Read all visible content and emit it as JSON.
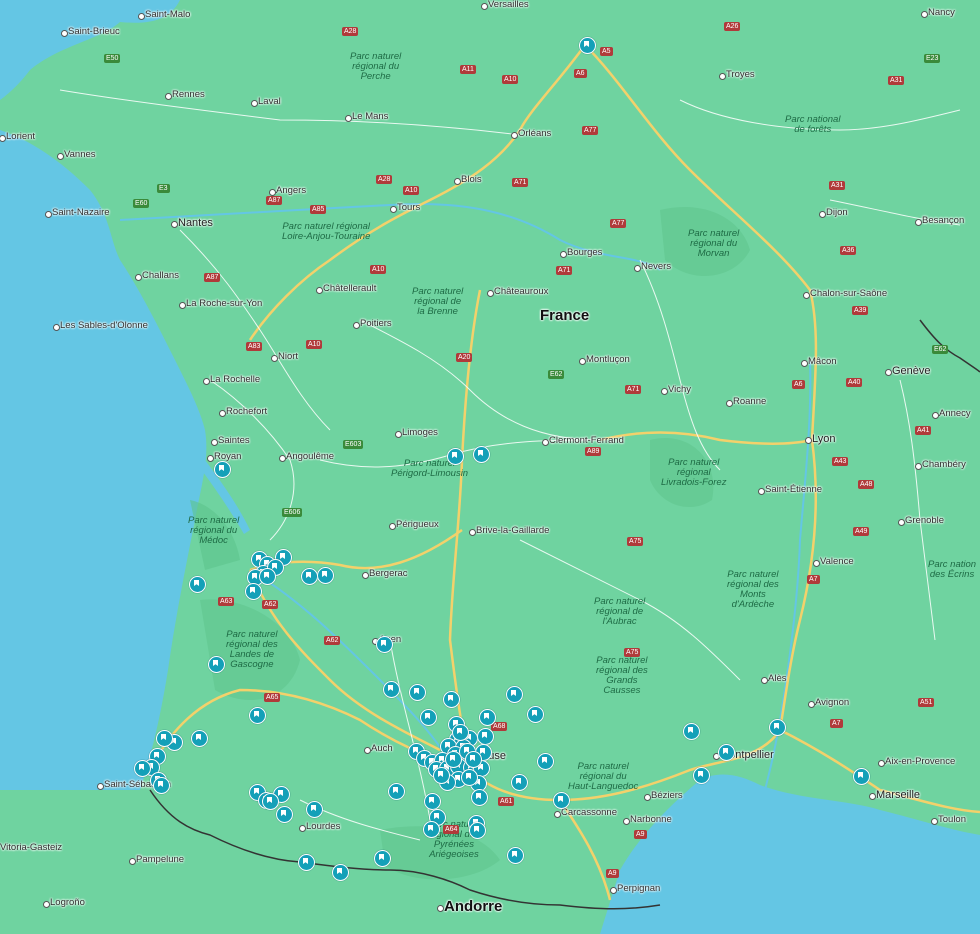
{
  "country_label": "France",
  "colors": {
    "land": "#6fd3a0",
    "sea": "#64c6e4",
    "road_major": "#f3d16b",
    "road_minor": "#ffffff",
    "marker": "#14a0b8",
    "park": "#5ec48c"
  },
  "cities": [
    "Versailles",
    "Nancy",
    "Saint-Malo",
    "Saint-Brieuc",
    "Rennes",
    "Laval",
    "Le Mans",
    "Orléans",
    "Troyes",
    "Lorient",
    "Vannes",
    "Angers",
    "Blois",
    "Tours",
    "Dijon",
    "Besançon",
    "Saint-Nazaire",
    "Nantes",
    "Bourges",
    "Nevers",
    "Challans",
    "Châtellerault",
    "Châteauroux",
    "La Roche-sur-Yon",
    "Chalon-sur-Saône",
    "Les Sables-d'Olonne",
    "Poitiers",
    "Niort",
    "Montluçon",
    "Mâcon",
    "Genève",
    "La Rochelle",
    "Vichy",
    "Roanne",
    "Annecy",
    "Rochefort",
    "Limoges",
    "Lyon",
    "Clermont-Ferrand",
    "Saintes",
    "Royan",
    "Angoulême",
    "Chambéry",
    "Saint-Étienne",
    "Grenoble",
    "Périgueux",
    "Brive-la-Gaillarde",
    "Valence",
    "Bergerac",
    "Agen",
    "Alès",
    "Avignon",
    "Montpellier",
    "Auch",
    "Toulouse",
    "Aix-en-Provence",
    "Saint-Sébastien",
    "Béziers",
    "Marseille",
    "Carcassonne",
    "Narbonne",
    "Toulon",
    "Lourdes",
    "Pampelune",
    "Perpignan",
    "Andorre",
    "Logroño",
    "Vitoria-Gasteiz"
  ],
  "parks": [
    "Parc naturel\nrégional du\nPerche",
    "Parc national\nde forêts",
    "Parc naturel régional\nLoire-Anjou-Touraine",
    "Parc naturel\nrégional du\nMorvan",
    "Parc naturel\nrégional de\nla Brenne",
    "Parc naturel\nPérigord-Limousin",
    "Parc naturel\nrégional\nLivradois-Forez",
    "Parc naturel\nrégional du\nMédoc",
    "Parc naturel\nrégional des\nMonts\nd'Ardèche",
    "Parc nation\ndes Écrins",
    "Parc naturel\nrégional de\nl'Aubrac",
    "Parc naturel\nrégional des\nLandes de\nGascogne",
    "Parc naturel\nrégional des\nGrands\nCausses",
    "Parc naturel\nrégional du\nHaut-Languedoc",
    "Parc naturel\nrégional des\nPyrénées\nAriégeoises"
  ],
  "roads": [
    "A28",
    "A26",
    "E50",
    "A11",
    "A10",
    "A6",
    "A5",
    "A31",
    "E23",
    "A77",
    "A28",
    "E60",
    "A87",
    "A85",
    "A10",
    "A71",
    "E3",
    "A77",
    "A36",
    "A31",
    "A87",
    "A10",
    "A71",
    "A83",
    "A10",
    "A20",
    "E62",
    "E62",
    "A6",
    "A39",
    "A40",
    "A71",
    "A89",
    "A41",
    "E603",
    "E606",
    "A43",
    "A48",
    "A75",
    "A49",
    "A7",
    "A62",
    "A63",
    "A75",
    "A62",
    "A65",
    "A68",
    "A51",
    "A7",
    "A61",
    "A9",
    "A64",
    "A9"
  ],
  "markers": {
    "count": 104,
    "icon": "bookmark-pin-icon"
  }
}
